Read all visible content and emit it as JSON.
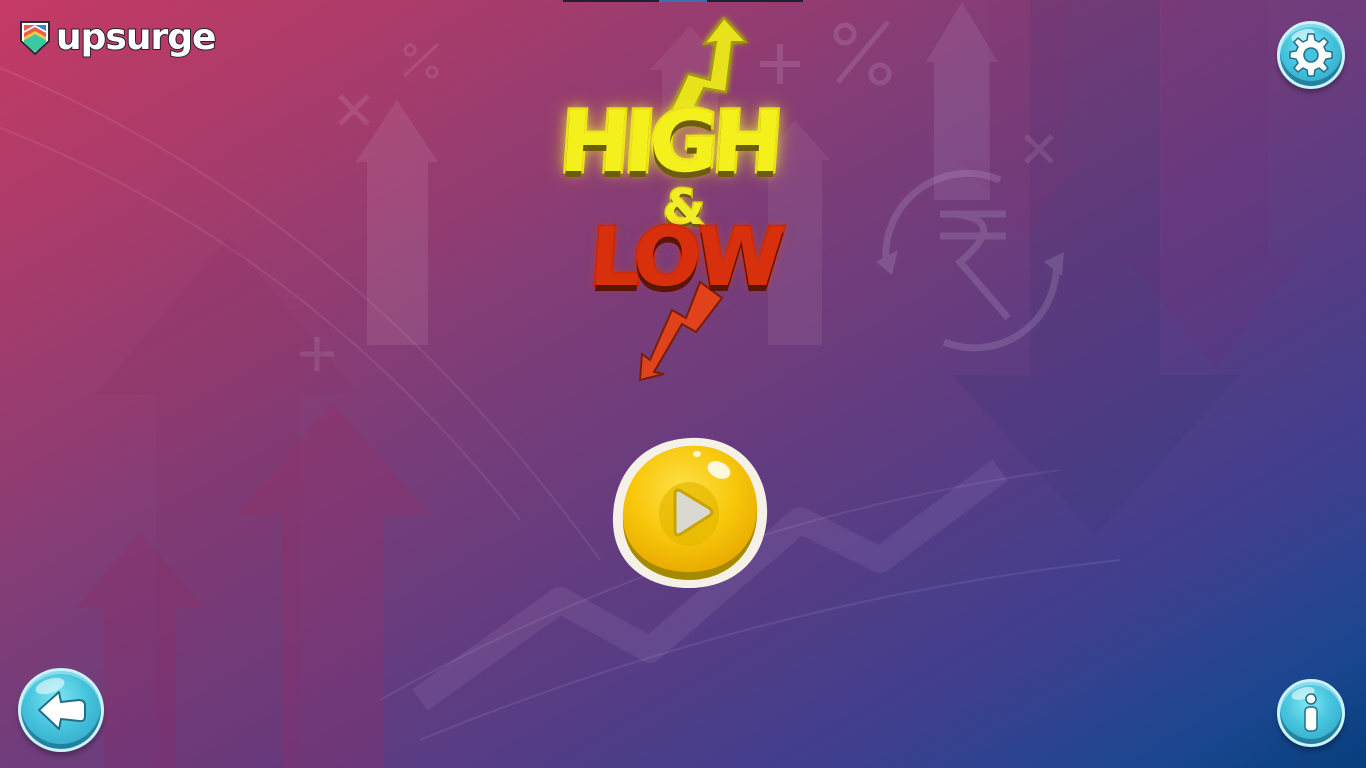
{
  "brand": {
    "logo_text": "upsurge",
    "logo_icon": "chevron-shield-icon"
  },
  "game": {
    "title_high": "HIGH",
    "title_amp": "&",
    "title_low": "LOW",
    "high_color": "#f4f01c",
    "low_color": "#d8300c"
  },
  "controls": {
    "settings_icon": "gear-icon",
    "back_icon": "back-arrow-icon",
    "info_icon": "info-icon",
    "play_icon": "play-icon"
  },
  "background": {
    "decorative_icons": [
      "up-arrow-icon",
      "down-arrow-icon",
      "rupee-cycle-icon",
      "percent-icon",
      "plus-icon",
      "multiply-icon"
    ]
  },
  "colors": {
    "button_cyan": "#45c3dd",
    "play_yellow": "#f5c400",
    "bg_top_left": "#c53a64",
    "bg_bottom_right": "#063e7d"
  }
}
